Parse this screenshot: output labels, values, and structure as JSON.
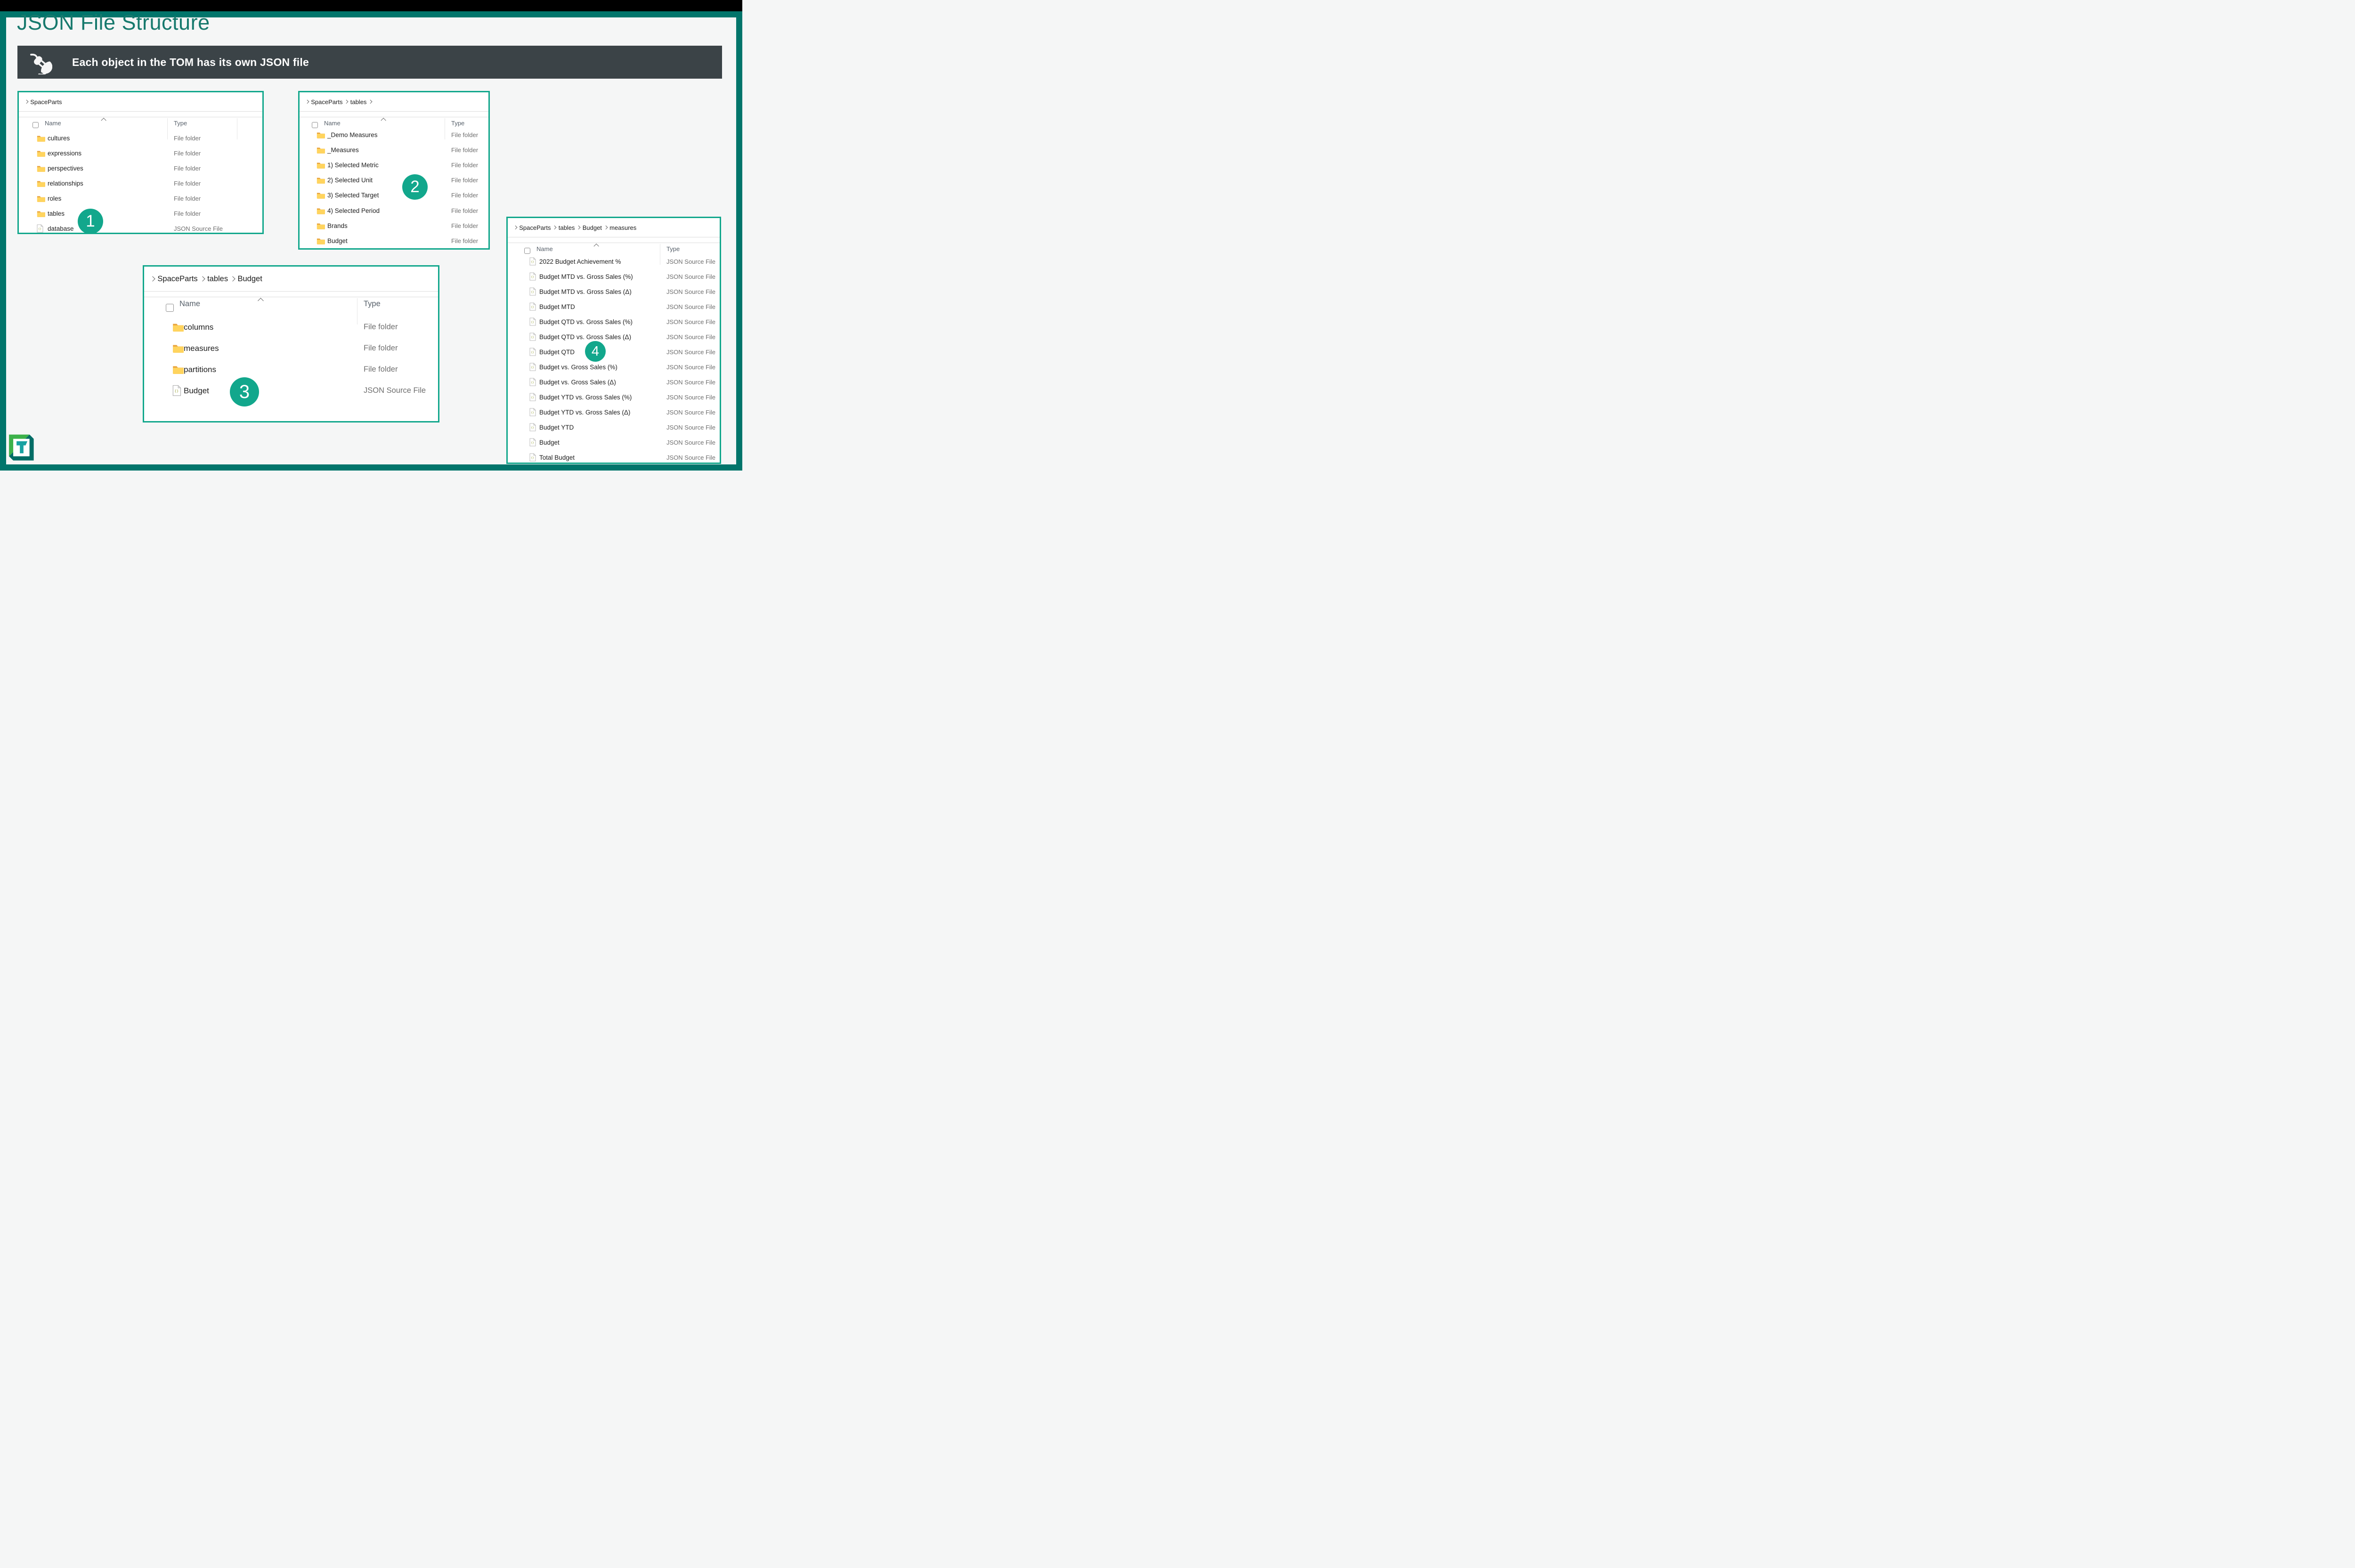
{
  "title": "JSON File Structure",
  "banner": {
    "text": "Each object in the TOM has its own JSON file",
    "icon": "plug-icon"
  },
  "colors": {
    "accent_teal": "#12a78c",
    "frame_teal": "#01756b",
    "title_teal": "#17796d",
    "banner_bg": "#3b4347",
    "folder_yellow": "#ffd45e",
    "folder_tab": "#e8a33b",
    "json_brace_olive": "#9aa339",
    "logo_green": "#3cb14a",
    "logo_dark_teal": "#016d66",
    "logo_t_teal": "#18a2a2"
  },
  "columns": {
    "name": "Name",
    "type": "Type"
  },
  "type_labels": {
    "folder": "File folder",
    "json": "JSON Source File"
  },
  "panels": [
    {
      "badge": "1",
      "breadcrumbs": [
        "SpaceParts"
      ],
      "trailing_chevron": false,
      "rows": [
        {
          "name": "cultures",
          "type": "File folder",
          "icon": "folder"
        },
        {
          "name": "expressions",
          "type": "File folder",
          "icon": "folder"
        },
        {
          "name": "perspectives",
          "type": "File folder",
          "icon": "folder"
        },
        {
          "name": "relationships",
          "type": "File folder",
          "icon": "folder"
        },
        {
          "name": "roles",
          "type": "File folder",
          "icon": "folder"
        },
        {
          "name": "tables",
          "type": "File folder",
          "icon": "folder"
        },
        {
          "name": "database",
          "type": "JSON Source File",
          "icon": "json"
        }
      ]
    },
    {
      "badge": "2",
      "breadcrumbs": [
        "SpaceParts",
        "tables"
      ],
      "trailing_chevron": true,
      "rows": [
        {
          "name": "_Demo Measures",
          "type": "File folder",
          "icon": "folder"
        },
        {
          "name": "_Measures",
          "type": "File folder",
          "icon": "folder"
        },
        {
          "name": "1) Selected Metric",
          "type": "File folder",
          "icon": "folder"
        },
        {
          "name": "2) Selected Unit",
          "type": "File folder",
          "icon": "folder"
        },
        {
          "name": "3) Selected Target",
          "type": "File folder",
          "icon": "folder"
        },
        {
          "name": "4) Selected Period",
          "type": "File folder",
          "icon": "folder"
        },
        {
          "name": "Brands",
          "type": "File folder",
          "icon": "folder"
        },
        {
          "name": "Budget",
          "type": "File folder",
          "icon": "folder"
        }
      ]
    },
    {
      "badge": "3",
      "breadcrumbs": [
        "SpaceParts",
        "tables",
        "Budget"
      ],
      "trailing_chevron": false,
      "rows": [
        {
          "name": "columns",
          "type": "File folder",
          "icon": "folder"
        },
        {
          "name": "measures",
          "type": "File folder",
          "icon": "folder"
        },
        {
          "name": "partitions",
          "type": "File folder",
          "icon": "folder"
        },
        {
          "name": "Budget",
          "type": "JSON Source File",
          "icon": "json"
        }
      ]
    },
    {
      "badge": "4",
      "breadcrumbs": [
        "SpaceParts",
        "tables",
        "Budget",
        "measures"
      ],
      "trailing_chevron": false,
      "rows": [
        {
          "name": "2022 Budget Achievement %",
          "type": "JSON Source File",
          "icon": "json"
        },
        {
          "name": "Budget MTD vs. Gross Sales (%)",
          "type": "JSON Source File",
          "icon": "json"
        },
        {
          "name": "Budget MTD vs. Gross Sales (Δ)",
          "type": "JSON Source File",
          "icon": "json"
        },
        {
          "name": "Budget MTD",
          "type": "JSON Source File",
          "icon": "json"
        },
        {
          "name": "Budget QTD vs. Gross Sales (%)",
          "type": "JSON Source File",
          "icon": "json"
        },
        {
          "name": "Budget QTD vs. Gross Sales (Δ)",
          "type": "JSON Source File",
          "icon": "json"
        },
        {
          "name": "Budget QTD",
          "type": "JSON Source File",
          "icon": "json"
        },
        {
          "name": "Budget vs. Gross Sales (%)",
          "type": "JSON Source File",
          "icon": "json"
        },
        {
          "name": "Budget vs. Gross Sales (Δ)",
          "type": "JSON Source File",
          "icon": "json"
        },
        {
          "name": "Budget YTD vs. Gross Sales (%)",
          "type": "JSON Source File",
          "icon": "json"
        },
        {
          "name": "Budget YTD vs. Gross Sales (Δ)",
          "type": "JSON Source File",
          "icon": "json"
        },
        {
          "name": "Budget YTD",
          "type": "JSON Source File",
          "icon": "json"
        },
        {
          "name": "Budget",
          "type": "JSON Source File",
          "icon": "json"
        },
        {
          "name": "Total Budget",
          "type": "JSON Source File",
          "icon": "json"
        }
      ]
    }
  ],
  "logo": {
    "name": "tabular-editor-logo"
  }
}
